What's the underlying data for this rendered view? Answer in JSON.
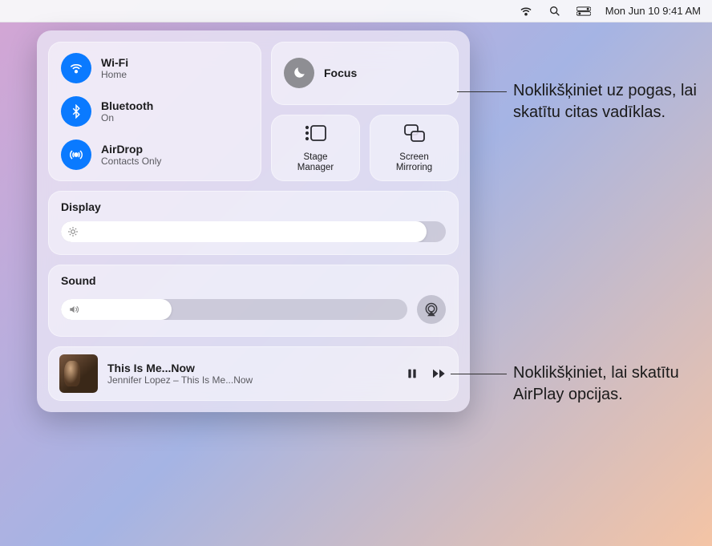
{
  "menubar": {
    "datetime": "Mon Jun 10  9:41 AM"
  },
  "network": {
    "wifi": {
      "title": "Wi-Fi",
      "sub": "Home"
    },
    "bluetooth": {
      "title": "Bluetooth",
      "sub": "On"
    },
    "airdrop": {
      "title": "AirDrop",
      "sub": "Contacts Only"
    }
  },
  "focus": {
    "title": "Focus"
  },
  "stage": {
    "label": "Stage\nManager"
  },
  "mirror": {
    "label": "Screen\nMirroring"
  },
  "display": {
    "title": "Display",
    "value": 95
  },
  "sound": {
    "title": "Sound",
    "value": 32
  },
  "nowplaying": {
    "title": "This Is Me...Now",
    "subtitle": "Jennifer Lopez – This Is Me...Now"
  },
  "callouts": {
    "focus": "Noklikšķiniet uz pogas, lai skatītu citas vadīklas.",
    "airplay": "Noklikšķiniet, lai skatītu AirPlay opcijas."
  }
}
